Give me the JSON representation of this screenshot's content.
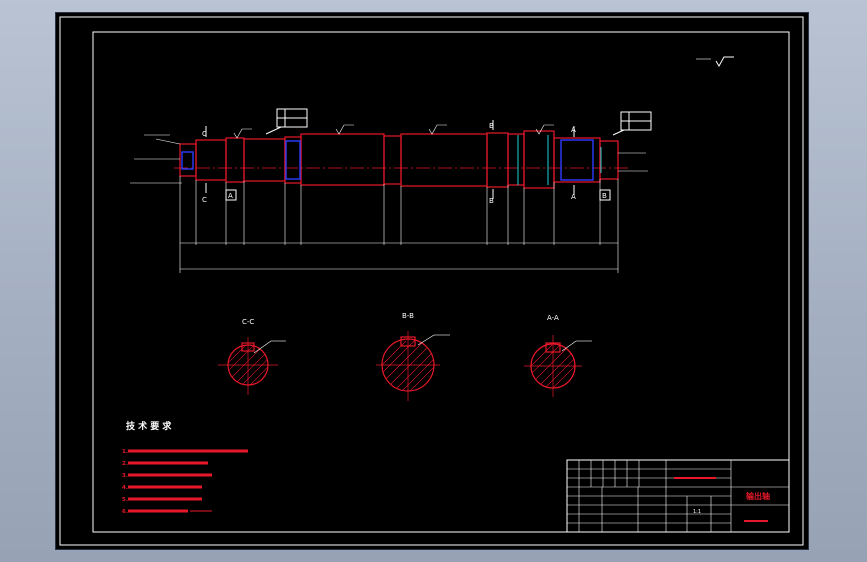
{
  "section_titles": {
    "cc": "C-C",
    "bb": "B-B",
    "aa": "A-A"
  },
  "section_markers": {
    "c": "C",
    "b": "B",
    "a": "A"
  },
  "datum_labels": [
    "A",
    "B"
  ],
  "tech_req": {
    "title": "技 术 要 求",
    "items": [
      "1.",
      "2.",
      "3.",
      "4.",
      "5.",
      "6."
    ]
  },
  "title_block": {
    "part_name": "输出轴",
    "material": "45",
    "scale": "1:1"
  },
  "colors": {
    "background": "#000000",
    "outline": "#ffffff",
    "part": "#e8182a",
    "keyway": "#2c3cff",
    "accent": "#18d4d4"
  }
}
